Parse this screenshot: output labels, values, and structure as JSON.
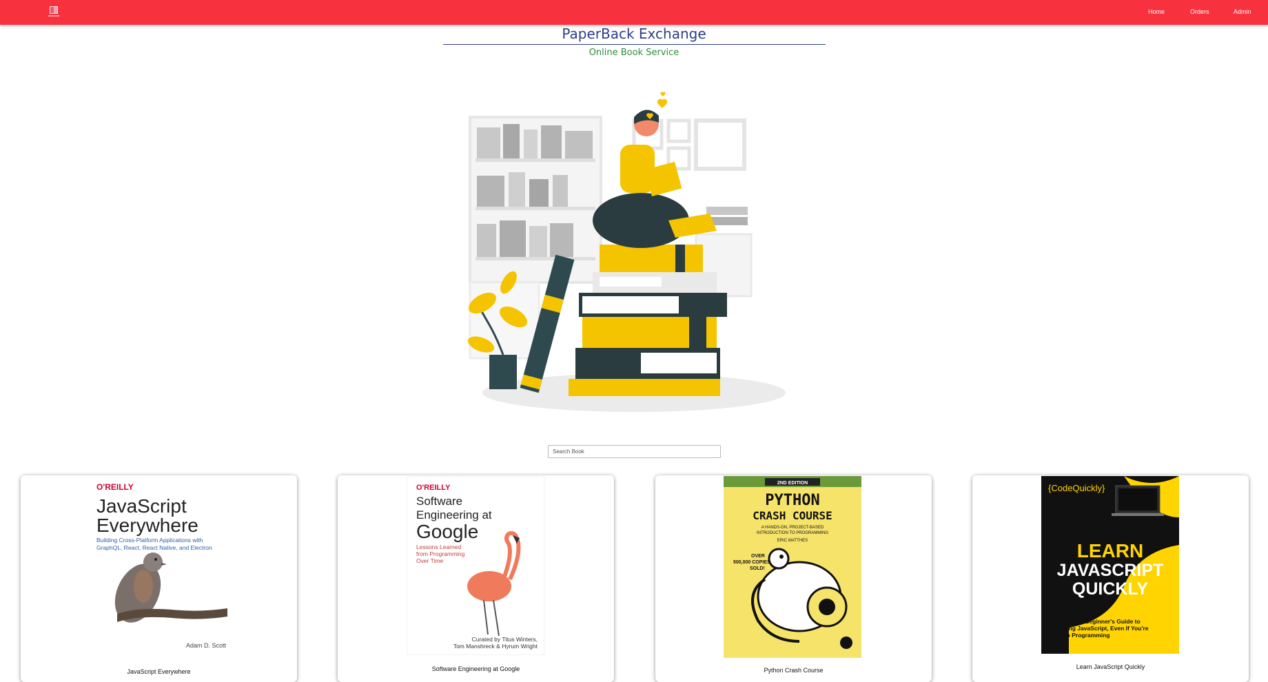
{
  "navbar": {
    "links": [
      {
        "label": "Home"
      },
      {
        "label": "Orders"
      },
      {
        "label": "Admin"
      }
    ],
    "bg_color": "#f8313f"
  },
  "header": {
    "title": "PaperBack Exchange",
    "subtitle": "Online Book Service"
  },
  "search": {
    "placeholder": "Search Book",
    "value": ""
  },
  "books": [
    {
      "title": "JavaScript Everywhere",
      "cover": {
        "publisher": "O'REILLY",
        "line1": "JavaScript",
        "line2": "Everywhere",
        "tagline1": "Building Cross-Platform Applications with",
        "tagline2": "GraphQL, React, React Native, and Electron",
        "author": "Adam D. Scott"
      }
    },
    {
      "title": "Software Engineering at Google",
      "cover": {
        "publisher": "O'REILLY",
        "line1": "Software",
        "line2": "Engineering at",
        "line3": "Google",
        "tagline1": "Lessons Learned",
        "tagline2": "from Programming",
        "tagline3": "Over Time",
        "author1": "Curated by Titus Winters,",
        "author2": "Tom Manshreck & Hyrum Wright"
      }
    },
    {
      "title": "Python Crash Course",
      "cover": {
        "edition": "2ND EDITION",
        "line1": "PYTHON",
        "line2": "CRASH COURSE",
        "tagline1": "A HANDS-ON, PROJECT-BASED",
        "tagline2": "INTRODUCTION TO PROGRAMMING",
        "author": "ERIC MATTHES",
        "badge1": "OVER",
        "badge2": "500,000 COPIES",
        "badge3": "SOLD!"
      }
    },
    {
      "title": "Learn JavaScript Quickly",
      "cover": {
        "brand": "{CodeQuickly}",
        "line1": "LEARN",
        "line2": "JAVASCRIPT",
        "line3": "QUICKLY",
        "tagline1": "A Complete Beginner's Guide to",
        "tagline2": "Learning JavaScript, Even If You're",
        "tagline3": "New to Programming"
      }
    }
  ]
}
